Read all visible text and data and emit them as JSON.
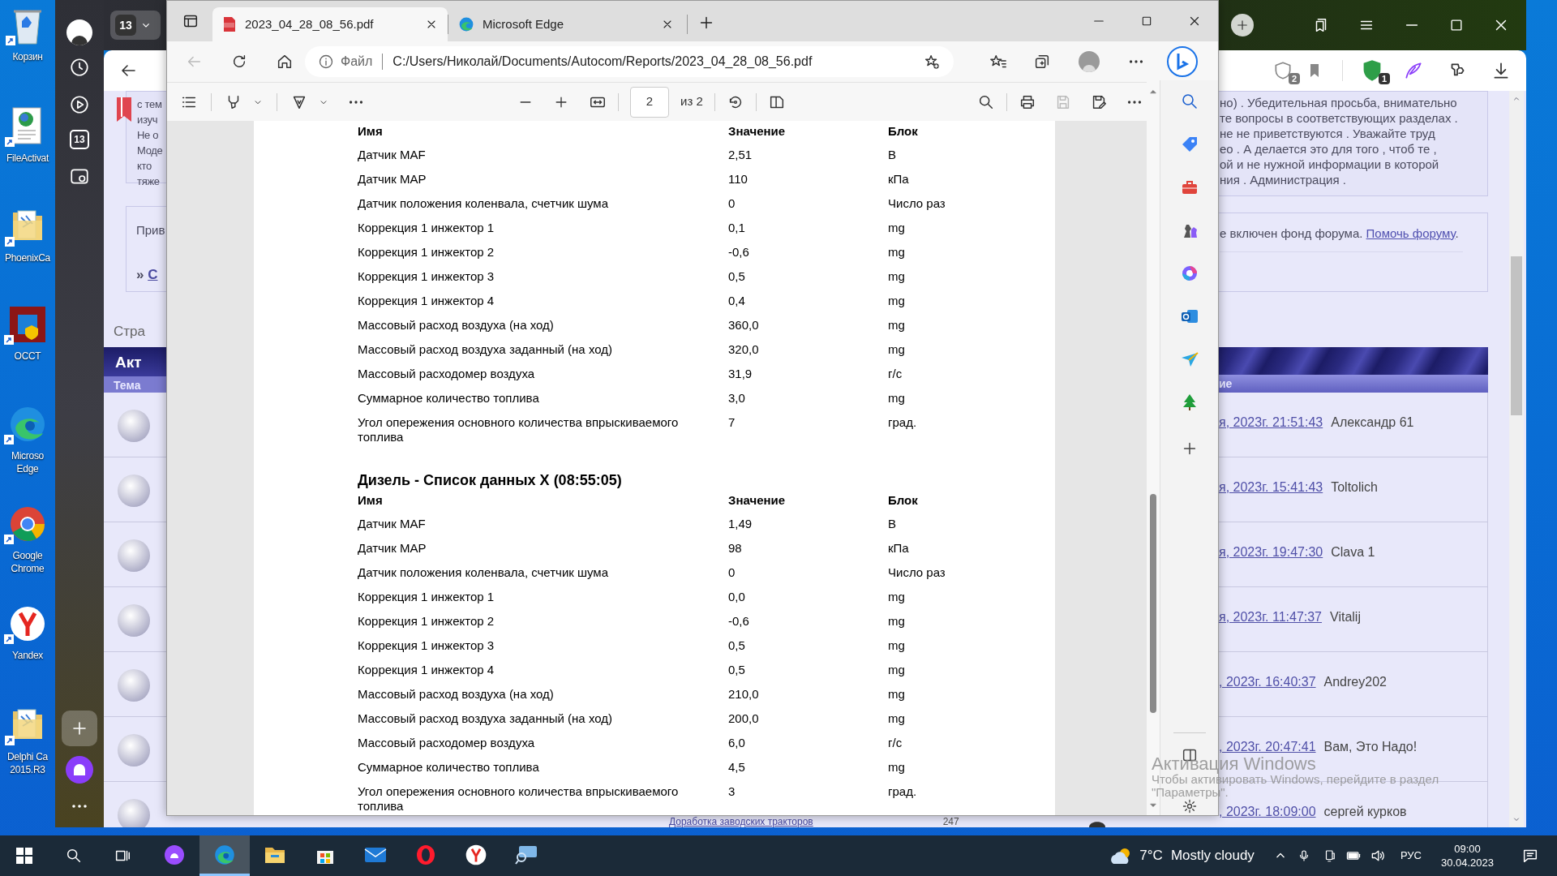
{
  "desktop_icons": [
    {
      "kind": "recycle",
      "lines": [
        "Корзин"
      ]
    },
    {
      "kind": "doc",
      "lines": [
        "FileActivat"
      ]
    },
    {
      "kind": "folder",
      "lines": [
        "PhoenixCa"
      ]
    },
    {
      "kind": "occt",
      "lines": [
        "OCCT"
      ]
    },
    {
      "kind": "edge",
      "lines": [
        "Microso",
        "Edge"
      ]
    },
    {
      "kind": "chrome",
      "lines": [
        "Google",
        "Chrome"
      ]
    },
    {
      "kind": "yandex",
      "lines": [
        "Yandex"
      ]
    },
    {
      "kind": "folder",
      "lines": [
        "Delphi Ca",
        "2015.R3"
      ]
    }
  ],
  "yandex_browser": {
    "tab_counter": "13",
    "sidebar_counter": "13",
    "protect_badge": "2",
    "extension_badge": "1",
    "page": {
      "notice_left": [
        "с тем",
        "изуч",
        "Не о",
        "Моде",
        "кто",
        "тяже"
      ],
      "notice_right": [
        "но) . Убедительная просьба, внимательно",
        "те вопросы в соответствующих разделах .",
        "не не приветствуются . Уважайте труд",
        "ео . А делается это для того , чтоб те ,",
        "ой и не нужной информации в которой",
        "ния . Администрация ."
      ],
      "fund_left": "Прив",
      "fund_left_link_prefix": "»",
      "fund_left_link": "С",
      "fund_right": "е включен фонд форума.",
      "fund_right_link": "Помочь форуму",
      "fund_right_after": ".",
      "pages_label": "Стра",
      "table": {
        "title": "Акт",
        "column_left": "Тема",
        "column_right": "ие",
        "rows": [
          {
            "date": "я, 2023г. 21:51:43",
            "author": "Александр 61"
          },
          {
            "date": "я, 2023г. 15:41:43",
            "author": "Toltolich"
          },
          {
            "date": "я, 2023г. 19:47:30",
            "author": "Clava 1"
          },
          {
            "date": "я, 2023г. 11:47:37",
            "author": "Vitalij"
          },
          {
            "date": ", 2023г. 16:40:37",
            "author": "Andrey202"
          },
          {
            "date": ", 2023г. 20:47:41",
            "author": "Вам, Это Надо!"
          },
          {
            "date": ", 2023г. 18:09:00",
            "author": "сергей курков"
          }
        ]
      },
      "bottom_row": {
        "topic": "Доработка заводских тракторов",
        "count": "247"
      }
    }
  },
  "edge": {
    "tabs": [
      {
        "title": "2023_04_28_08_56.pdf",
        "kind": "pdf",
        "selected": true
      },
      {
        "title": "Microsoft Edge",
        "kind": "edge",
        "selected": false
      }
    ],
    "address": {
      "scheme": "Файл",
      "url": "C:/Users/Николай/Documents/Autocom/Reports/2023_04_28_08_56.pdf"
    },
    "pdf_toolbar": {
      "page": "2",
      "page_count": "из 2",
      "save_disabled": true
    },
    "document": {
      "sections": [
        {
          "columns": [
            "Имя",
            "Значение",
            "Блок"
          ],
          "rows": [
            {
              "name": "Датчик MAF",
              "value": "2,51",
              "unit": "В"
            },
            {
              "name": "Датчик MAP",
              "value": "110",
              "unit": "кПа"
            },
            {
              "name": "Датчик положения коленвала, счетчик шума",
              "value": "0",
              "unit": "Число раз"
            },
            {
              "name": "Коррекция 1 инжектор 1",
              "value": "0,1",
              "unit": "mg"
            },
            {
              "name": "Коррекция 1 инжектор 2",
              "value": "-0,6",
              "unit": "mg"
            },
            {
              "name": "Коррекция 1 инжектор 3",
              "value": "0,5",
              "unit": "mg"
            },
            {
              "name": "Коррекция 1 инжектор 4",
              "value": "0,4",
              "unit": "mg"
            },
            {
              "name": "Массовый расход воздуха (на ход)",
              "value": "360,0",
              "unit": "mg"
            },
            {
              "name": "Массовый расход воздуха заданный (на ход)",
              "value": "320,0",
              "unit": "mg"
            },
            {
              "name": "Массовый расходомер воздуха",
              "value": "31,9",
              "unit": "г/с"
            },
            {
              "name": "Суммарное количество топлива",
              "value": "3,0",
              "unit": "mg"
            },
            {
              "name": "Угол опережения основного количества впрыскиваемого топлива",
              "value": "7",
              "unit": "град."
            }
          ]
        },
        {
          "title": "Дизель - Список данных X (08:55:05)",
          "columns": [
            "Имя",
            "Значение",
            "Блок"
          ],
          "rows": [
            {
              "name": "Датчик MAF",
              "value": "1,49",
              "unit": "В"
            },
            {
              "name": "Датчик MAP",
              "value": "98",
              "unit": "кПа"
            },
            {
              "name": "Датчик положения коленвала, счетчик шума",
              "value": "0",
              "unit": "Число раз"
            },
            {
              "name": "Коррекция 1 инжектор 1",
              "value": "0,0",
              "unit": "mg"
            },
            {
              "name": "Коррекция 1 инжектор 2",
              "value": "-0,6",
              "unit": "mg"
            },
            {
              "name": "Коррекция 1 инжектор 3",
              "value": "0,5",
              "unit": "mg"
            },
            {
              "name": "Коррекция 1 инжектор 4",
              "value": "0,5",
              "unit": "mg"
            },
            {
              "name": "Массовый расход воздуха (на ход)",
              "value": "210,0",
              "unit": "mg"
            },
            {
              "name": "Массовый расход воздуха заданный (на ход)",
              "value": "200,0",
              "unit": "mg"
            },
            {
              "name": "Массовый расходомер воздуха",
              "value": "6,0",
              "unit": "г/с"
            },
            {
              "name": "Суммарное количество топлива",
              "value": "4,5",
              "unit": "mg"
            },
            {
              "name": "Угол опережения основного количества впрыскиваемого топлива",
              "value": "3",
              "unit": "град."
            }
          ]
        }
      ]
    }
  },
  "activation": {
    "title": "Активация Windows",
    "lines": [
      "Чтобы активировать Windows, перейдите в раздел",
      "\"Параметры\"."
    ]
  },
  "taskbar": {
    "apps": [
      {
        "kind": "alice",
        "active": false
      },
      {
        "kind": "edge",
        "active": true
      },
      {
        "kind": "explorer",
        "active": false
      },
      {
        "kind": "store",
        "active": false
      },
      {
        "kind": "mail",
        "active": false
      },
      {
        "kind": "opera",
        "active": false
      },
      {
        "kind": "yandex",
        "active": false
      },
      {
        "kind": "magnifier",
        "active": false
      }
    ],
    "weather": {
      "temperature": "7°C",
      "condition": "Mostly cloudy"
    },
    "language": "РУС",
    "time": "09:00",
    "date": "30.04.2023"
  }
}
